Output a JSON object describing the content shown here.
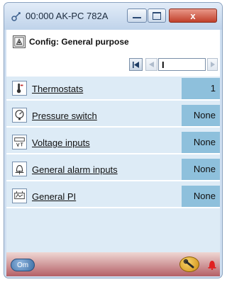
{
  "window": {
    "title": "00:000 AK-PC 782A",
    "close_glyph": "x"
  },
  "header": {
    "config_title": "Config: General purpose"
  },
  "pager": {
    "page_value": "I"
  },
  "rows": [
    {
      "label": "Thermostats",
      "value": "1",
      "icon": "thermostat-icon"
    },
    {
      "label": "Pressure switch",
      "value": "None",
      "icon": "pressure-gauge-icon"
    },
    {
      "label": "Voltage inputs",
      "value": "None",
      "icon": "voltage-input-icon"
    },
    {
      "label": "General alarm inputs",
      "value": "None",
      "icon": "alarm-input-icon"
    },
    {
      "label": "General PI",
      "value": "None",
      "icon": "pi-controller-icon"
    }
  ],
  "status_bar": {
    "left_label": "Om"
  },
  "colors": {
    "table_bg": "#ddebf6",
    "value_cell": "#8ec0dc",
    "close_button": "#c1402b",
    "alarm_bell": "#e02020"
  }
}
